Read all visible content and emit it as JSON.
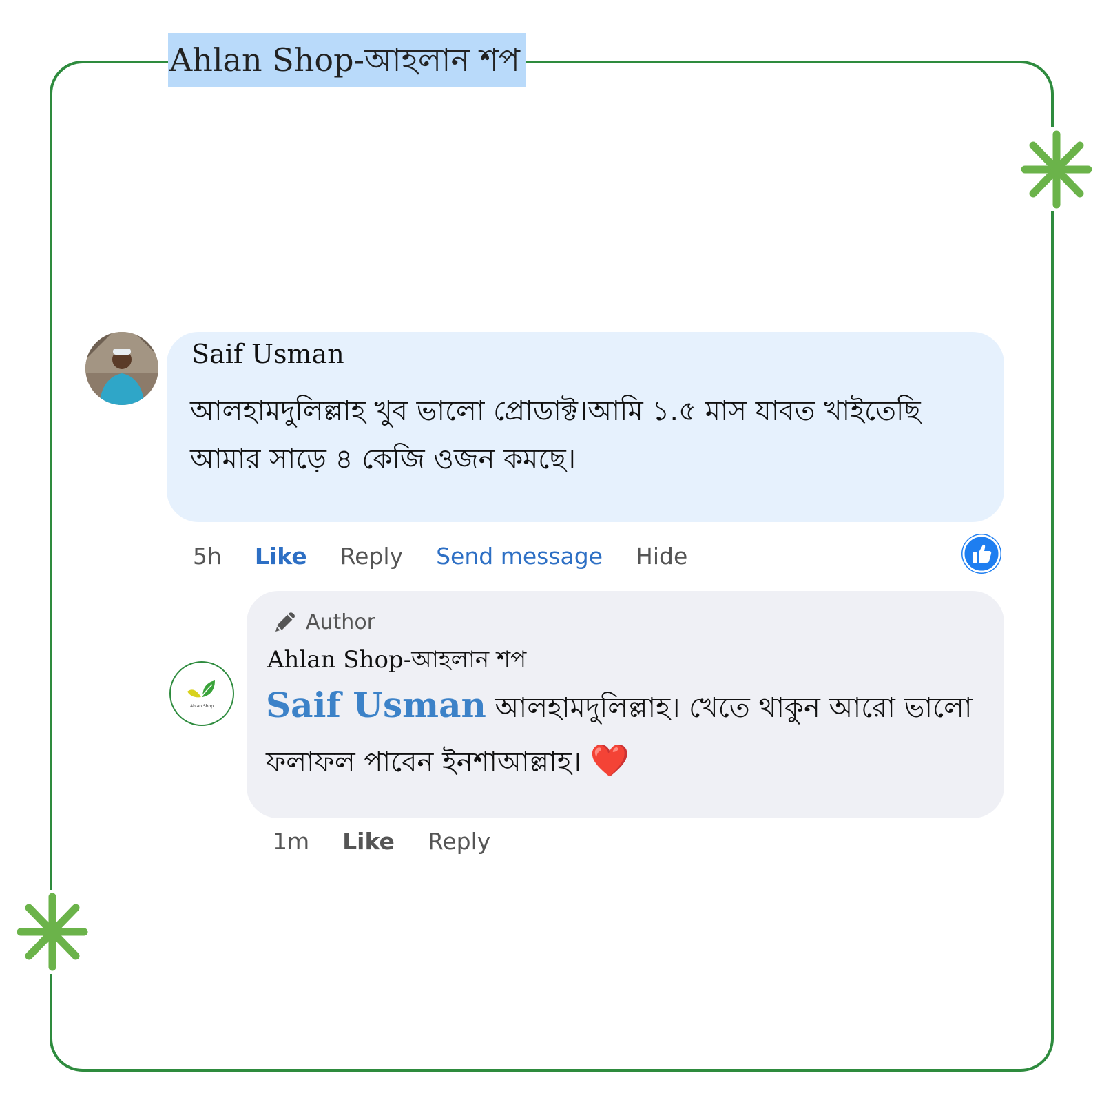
{
  "page": {
    "title": "Ahlan Shop-আহলান শপ",
    "colors": {
      "frame": "#2e8b3e",
      "title_highlight": "#b9dafa",
      "star": "#6bb34a",
      "link_blue": "#2d6fc4",
      "like_badge": "#1e7ef0"
    }
  },
  "comment": {
    "author": "Saif Usman",
    "text": "আলহামদুলিল্লাহ খুব ভালো প্রোডাক্ট।আমি ১.৫ মাস যাবত খাইতেছি আমার সাড়ে ৪ কেজি ওজন কমছে।",
    "time": "5h",
    "actions": {
      "like": "Like",
      "reply": "Reply",
      "send_message": "Send message",
      "hide": "Hide"
    },
    "reaction_icon": "thumbs-up-icon"
  },
  "reply": {
    "badge": "Author",
    "badge_icon": "pencil-icon",
    "author": "Ahlan Shop-আহলান শপ",
    "mention": "Saif Usman",
    "text": "আলহামদুলিল্লাহ। খেতে থাকুন আরো ভালো ফলাফল পাবেন ইনশাআল্লাহ।",
    "emoji": "❤️",
    "time": "1m",
    "actions": {
      "like": "Like",
      "reply": "Reply"
    },
    "logo_text": "Ahlan Shop"
  }
}
